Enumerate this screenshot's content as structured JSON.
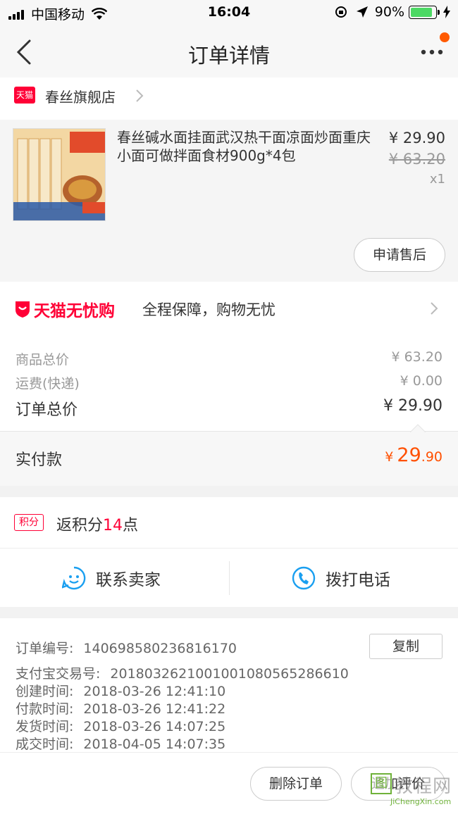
{
  "status_bar": {
    "carrier": "中国移动",
    "time": "16:04",
    "battery": "90%"
  },
  "nav": {
    "title": "订单详情"
  },
  "shop": {
    "badge": "天猫",
    "name": "春丝旗舰店"
  },
  "product": {
    "name": "春丝碱水面挂面武汉热干面凉面炒面重庆小面可做拌面食材900g*4包",
    "price": "¥ 29.90",
    "original_price": "¥ 63.20",
    "quantity": "x1",
    "after_sale_button": "申请售后"
  },
  "guarantee": {
    "brand": "天猫无忧购",
    "slogan": "全程保障，购物无忧"
  },
  "summary": {
    "items_total_label": "商品总价",
    "items_total_value": "¥ 63.20",
    "shipping_label": "运费(快递)",
    "shipping_value": "¥ 0.00",
    "order_total_label": "订单总价",
    "order_total_value": "¥ 29.90"
  },
  "payment": {
    "label": "实付款",
    "currency": "¥",
    "amount_int": "29",
    "amount_dec": ".90"
  },
  "points": {
    "tag": "积分",
    "prefix": "返积分",
    "number": "14",
    "suffix": "点"
  },
  "contact": {
    "seller": "联系卖家",
    "phone": "拨打电话"
  },
  "order_info": {
    "order_no_label": "订单编号:",
    "order_no": "140698580236816170",
    "copy_button": "复制",
    "alipay_label": "支付宝交易号:",
    "alipay_no": "2018032621001001080565286610",
    "created_label": "创建时间:",
    "created": "2018-03-26 12:41:10",
    "paid_label": "付款时间:",
    "paid": "2018-03-26 12:41:22",
    "shipped_label": "发货时间:",
    "shipped": "2018-03-26 14:07:25",
    "completed_label": "成交时间:",
    "completed": "2018-04-05 14:07:35"
  },
  "footer": {
    "delete_button": "删除订单",
    "review_button": "追加评价"
  },
  "watermark": {
    "text": "教程网",
    "mark": "图",
    "url": "JiChengXin.com"
  },
  "colors": {
    "tmall_red": "#ff0036",
    "price_orange": "#ff5000",
    "battery_green": "#4cd964"
  }
}
